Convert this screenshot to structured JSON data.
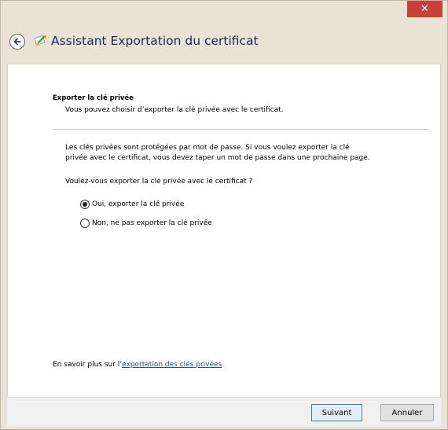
{
  "window": {
    "title": "Assistant Exportation du certificat",
    "close_label": "✕"
  },
  "page": {
    "section_title": "Exporter la clé privée",
    "section_subtitle": "Vous pouvez choisir d’exporter la clé privée avec le certificat.",
    "description_line1": "Les clés privées sont protégées par mot de passe. Si vous voulez exporter la clé",
    "description_line2": "privée avec le certificat, vous devez taper un mot de passe dans une prochaine page.",
    "question": "Voulez-vous exporter la clé privée avec le certificat ?",
    "options": [
      {
        "label": "Oui, exporter la clé privée",
        "selected": true
      },
      {
        "label": "Non, ne pas exporter la clé privée",
        "selected": false
      }
    ],
    "learn_more_prefix": "En savoir plus sur l’",
    "learn_more_link": "exportation des clés privées"
  },
  "footer": {
    "next_label": "Suivant",
    "cancel_label": "Annuler"
  },
  "colors": {
    "title_text": "#1b2a54",
    "close_button": "#c7403a",
    "link": "#0a59b2",
    "frame": "#e8e3d4"
  }
}
